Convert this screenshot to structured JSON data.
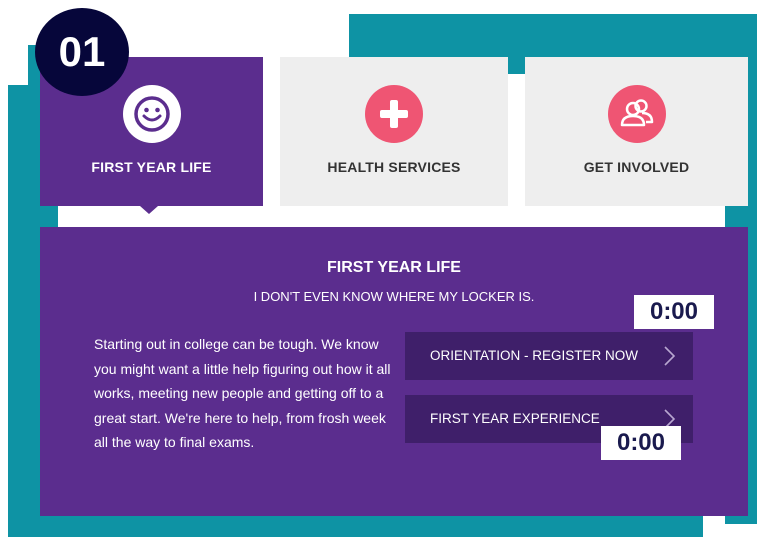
{
  "step_badge": "01",
  "tabs": [
    {
      "label": "FIRST YEAR LIFE",
      "icon": "smiley-icon",
      "active": true
    },
    {
      "label": "HEALTH SERVICES",
      "icon": "plus-icon",
      "active": false
    },
    {
      "label": "GET INVOLVED",
      "icon": "people-icon",
      "active": false
    }
  ],
  "content": {
    "title": "FIRST YEAR LIFE",
    "subtitle": "I DON'T EVEN KNOW WHERE MY LOCKER IS.",
    "description": "Starting out in college can be tough. We know you might want a little help figuring out how it all works, meeting new people and getting off to a great start. We're here to help, from frosh week all the way to final exams."
  },
  "buttons": [
    {
      "label": "ORIENTATION - REGISTER NOW"
    },
    {
      "label": "FIRST YEAR EXPERIENCE"
    }
  ],
  "timers": [
    "0:00",
    "0:00"
  ],
  "colors": {
    "teal": "#0e93a4",
    "purple": "#5b2d8e",
    "dark_purple": "#3f1f6a",
    "pink": "#ef5573",
    "navy": "#06063a"
  }
}
